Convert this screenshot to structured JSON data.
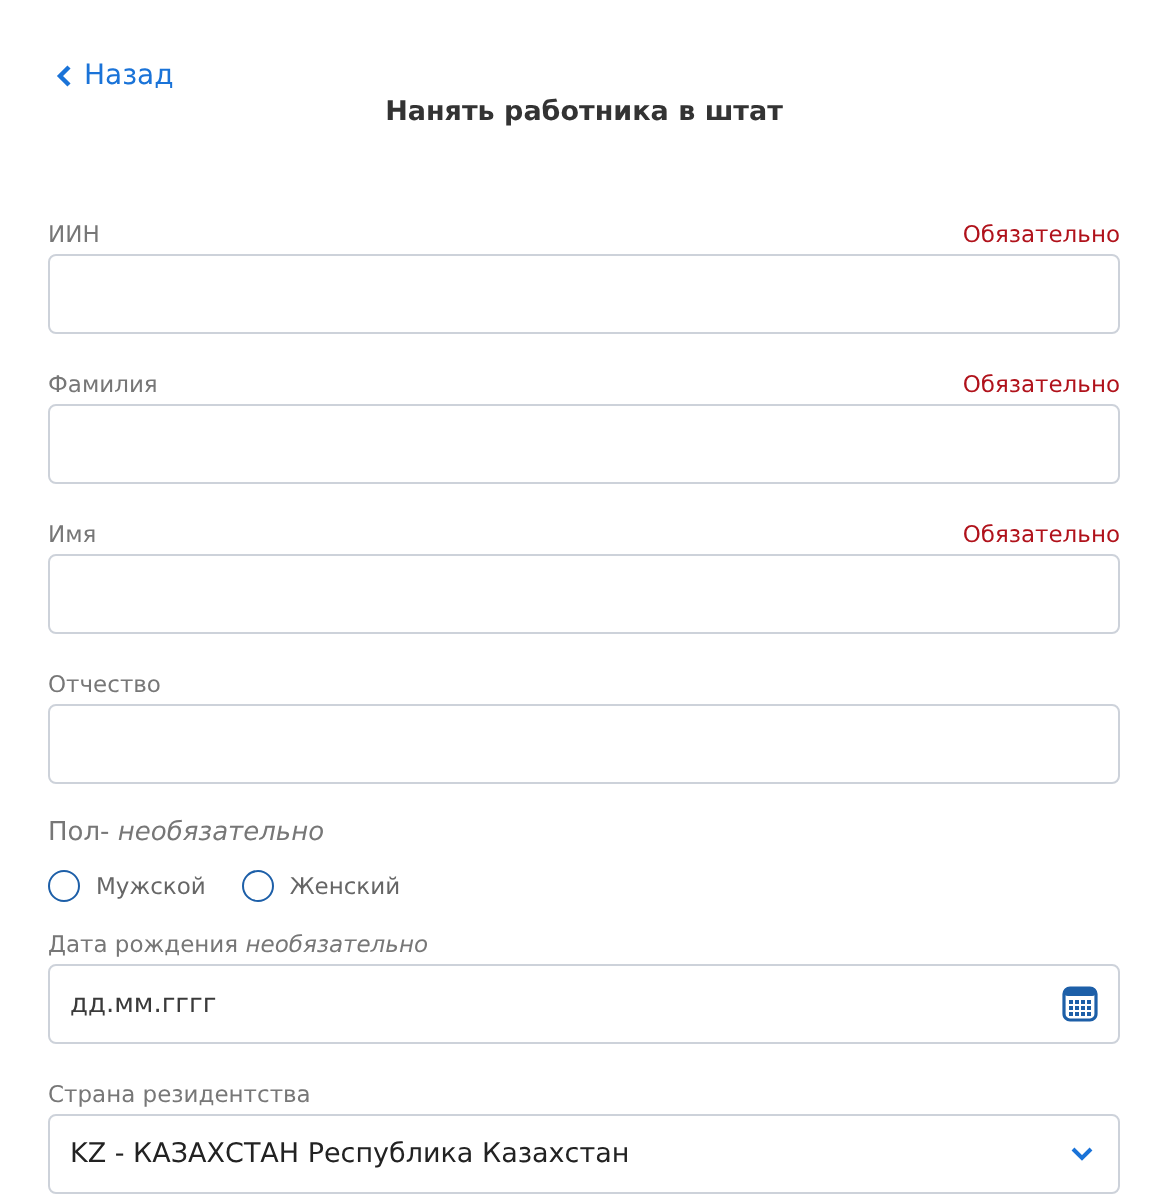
{
  "back_link": "Назад",
  "title": "Нанять работника в штат",
  "fields": [
    {
      "label": "ИИН",
      "required_note": "Обязательно"
    },
    {
      "label": "Фамилия",
      "required_note": "Обязательно"
    },
    {
      "label": "Имя",
      "required_note": "Обязательно"
    },
    {
      "label": "Отчество"
    }
  ],
  "gender": {
    "label": "Пол- *необязательно*",
    "options": [
      {
        "label": "Мужской",
        "selected": false
      },
      {
        "label": "Женский",
        "selected": false
      }
    ]
  },
  "birth_date": {
    "label": "Дата рождения *необязательно*",
    "placeholder": "дд.мм.гггг"
  },
  "country": {
    "label": "Страна резидентства",
    "value": "KZ - КАЗАХСТАН Республика Казахстан"
  }
}
